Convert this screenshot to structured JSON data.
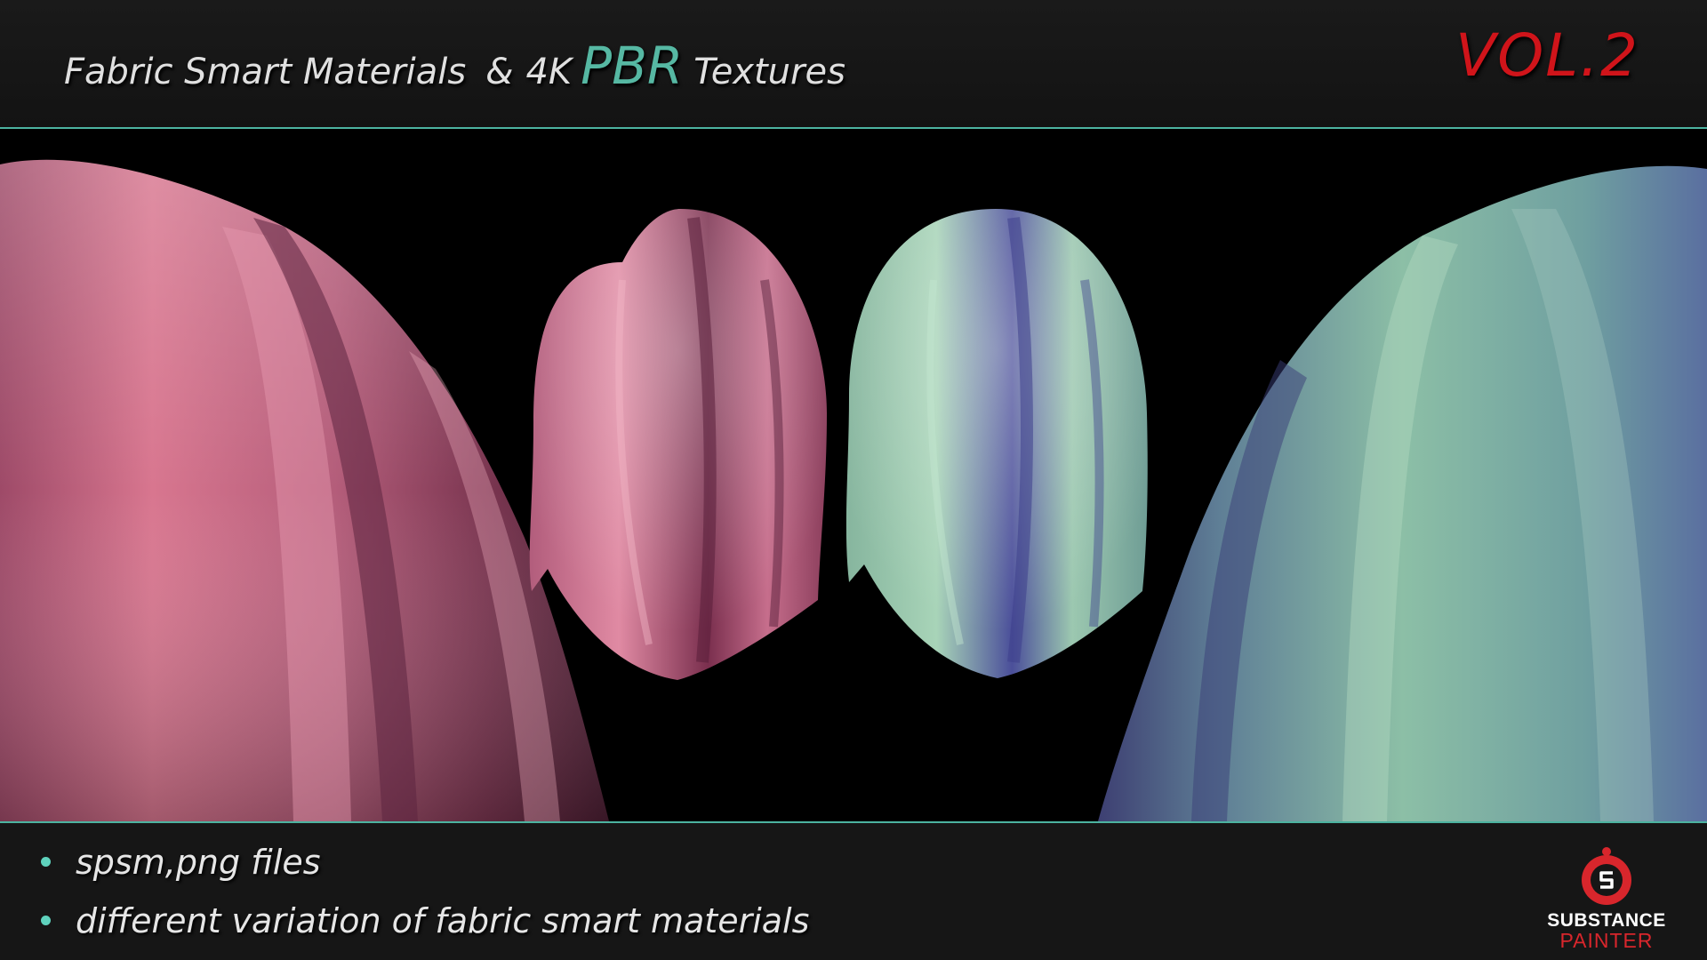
{
  "header": {
    "title_main": "Fabric Smart Materials",
    "title_amp": "&",
    "title_4k": "4K",
    "title_pbr": "PBR",
    "title_textures": "Textures",
    "volume_label": "VOL.2"
  },
  "preview": {
    "materials": [
      {
        "name": "pink-fabric",
        "color": "#c26a85"
      },
      {
        "name": "teal-fabric",
        "color": "#8fc0a8"
      }
    ]
  },
  "features": [
    "spsm,png files",
    "different variation of fabric smart materials"
  ],
  "logo": {
    "line1": "SUBSTANCE",
    "line2": "PAINTER",
    "icon": "substance-painter-icon"
  },
  "colors": {
    "accent": "#4cb3a0",
    "pbr": "#56b8a3",
    "volume": "#d0141a",
    "logo_red": "#d8262c"
  }
}
